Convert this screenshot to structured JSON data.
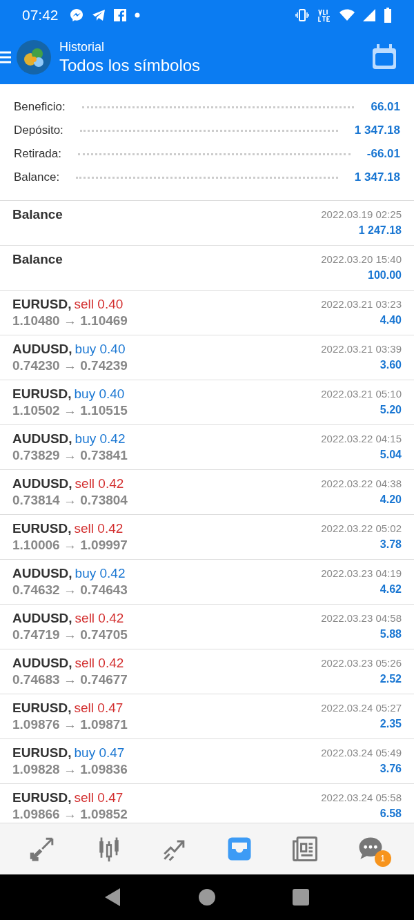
{
  "status_bar": {
    "time": "07:42"
  },
  "header": {
    "subtitle": "Historial",
    "title": "Todos los símbolos"
  },
  "summary": [
    {
      "label": "Beneficio:",
      "value": "66.01"
    },
    {
      "label": "Depósito:",
      "value": "1 347.18"
    },
    {
      "label": "Retirada:",
      "value": "-66.01"
    },
    {
      "label": "Balance:",
      "value": "1 347.18"
    }
  ],
  "deals": [
    {
      "kind": "balance",
      "title": "Balance",
      "time": "2022.03.19 02:25",
      "amount": "1 247.18"
    },
    {
      "kind": "balance",
      "title": "Balance",
      "time": "2022.03.20 15:40",
      "amount": "100.00"
    },
    {
      "kind": "trade",
      "symbol": "EURUSD,",
      "direction": "sell",
      "volume": "0.40",
      "prices": "1.10480 → 1.10469",
      "time": "2022.03.21 03:23",
      "amount": "4.40"
    },
    {
      "kind": "trade",
      "symbol": "AUDUSD,",
      "direction": "buy",
      "volume": "0.40",
      "prices": "0.74230 → 0.74239",
      "time": "2022.03.21 03:39",
      "amount": "3.60"
    },
    {
      "kind": "trade",
      "symbol": "EURUSD,",
      "direction": "buy",
      "volume": "0.40",
      "prices": "1.10502 → 1.10515",
      "time": "2022.03.21 05:10",
      "amount": "5.20"
    },
    {
      "kind": "trade",
      "symbol": "AUDUSD,",
      "direction": "buy",
      "volume": "0.42",
      "prices": "0.73829 → 0.73841",
      "time": "2022.03.22 04:15",
      "amount": "5.04"
    },
    {
      "kind": "trade",
      "symbol": "AUDUSD,",
      "direction": "sell",
      "volume": "0.42",
      "prices": "0.73814 → 0.73804",
      "time": "2022.03.22 04:38",
      "amount": "4.20"
    },
    {
      "kind": "trade",
      "symbol": "EURUSD,",
      "direction": "sell",
      "volume": "0.42",
      "prices": "1.10006 → 1.09997",
      "time": "2022.03.22 05:02",
      "amount": "3.78"
    },
    {
      "kind": "trade",
      "symbol": "AUDUSD,",
      "direction": "buy",
      "volume": "0.42",
      "prices": "0.74632 → 0.74643",
      "time": "2022.03.23 04:19",
      "amount": "4.62"
    },
    {
      "kind": "trade",
      "symbol": "AUDUSD,",
      "direction": "sell",
      "volume": "0.42",
      "prices": "0.74719 → 0.74705",
      "time": "2022.03.23 04:58",
      "amount": "5.88"
    },
    {
      "kind": "trade",
      "symbol": "AUDUSD,",
      "direction": "sell",
      "volume": "0.42",
      "prices": "0.74683 → 0.74677",
      "time": "2022.03.23 05:26",
      "amount": "2.52"
    },
    {
      "kind": "trade",
      "symbol": "EURUSD,",
      "direction": "sell",
      "volume": "0.47",
      "prices": "1.09876 → 1.09871",
      "time": "2022.03.24 05:27",
      "amount": "2.35"
    },
    {
      "kind": "trade",
      "symbol": "EURUSD,",
      "direction": "buy",
      "volume": "0.47",
      "prices": "1.09828 → 1.09836",
      "time": "2022.03.24 05:49",
      "amount": "3.76"
    },
    {
      "kind": "trade",
      "symbol": "EURUSD,",
      "direction": "sell",
      "volume": "0.47",
      "prices": "1.09866 → 1.09852",
      "time": "2022.03.24 05:58",
      "amount": "6.58"
    }
  ],
  "nav": [
    {
      "kind": "quotes",
      "selected": false
    },
    {
      "kind": "chart",
      "selected": false
    },
    {
      "kind": "trade",
      "selected": false
    },
    {
      "kind": "history",
      "selected": true
    },
    {
      "kind": "news",
      "selected": false
    },
    {
      "kind": "chat",
      "selected": false,
      "badge": "1"
    }
  ]
}
